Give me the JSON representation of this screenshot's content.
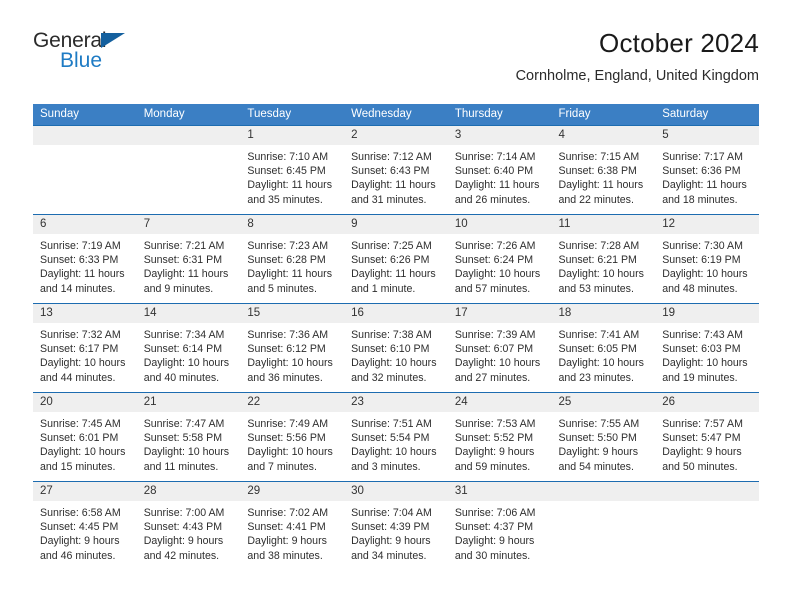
{
  "brand": {
    "name_part1": "General",
    "name_part2": "Blue",
    "triangle_color": "#14609e",
    "blue_color": "#1e7bc4"
  },
  "header": {
    "title": "October 2024",
    "subtitle": "Cornholme, England, United Kingdom"
  },
  "theme": {
    "header_row_bg": "#3b7fc4",
    "week_divider": "#1d6cb0",
    "daynum_bg": "#efefef"
  },
  "weekdays": [
    "Sunday",
    "Monday",
    "Tuesday",
    "Wednesday",
    "Thursday",
    "Friday",
    "Saturday"
  ],
  "weeks": [
    [
      {
        "day": "",
        "sunrise": "",
        "sunset": "",
        "daylight": ""
      },
      {
        "day": "",
        "sunrise": "",
        "sunset": "",
        "daylight": ""
      },
      {
        "day": "1",
        "sunrise": "Sunrise: 7:10 AM",
        "sunset": "Sunset: 6:45 PM",
        "daylight": "Daylight: 11 hours and 35 minutes."
      },
      {
        "day": "2",
        "sunrise": "Sunrise: 7:12 AM",
        "sunset": "Sunset: 6:43 PM",
        "daylight": "Daylight: 11 hours and 31 minutes."
      },
      {
        "day": "3",
        "sunrise": "Sunrise: 7:14 AM",
        "sunset": "Sunset: 6:40 PM",
        "daylight": "Daylight: 11 hours and 26 minutes."
      },
      {
        "day": "4",
        "sunrise": "Sunrise: 7:15 AM",
        "sunset": "Sunset: 6:38 PM",
        "daylight": "Daylight: 11 hours and 22 minutes."
      },
      {
        "day": "5",
        "sunrise": "Sunrise: 7:17 AM",
        "sunset": "Sunset: 6:36 PM",
        "daylight": "Daylight: 11 hours and 18 minutes."
      }
    ],
    [
      {
        "day": "6",
        "sunrise": "Sunrise: 7:19 AM",
        "sunset": "Sunset: 6:33 PM",
        "daylight": "Daylight: 11 hours and 14 minutes."
      },
      {
        "day": "7",
        "sunrise": "Sunrise: 7:21 AM",
        "sunset": "Sunset: 6:31 PM",
        "daylight": "Daylight: 11 hours and 9 minutes."
      },
      {
        "day": "8",
        "sunrise": "Sunrise: 7:23 AM",
        "sunset": "Sunset: 6:28 PM",
        "daylight": "Daylight: 11 hours and 5 minutes."
      },
      {
        "day": "9",
        "sunrise": "Sunrise: 7:25 AM",
        "sunset": "Sunset: 6:26 PM",
        "daylight": "Daylight: 11 hours and 1 minute."
      },
      {
        "day": "10",
        "sunrise": "Sunrise: 7:26 AM",
        "sunset": "Sunset: 6:24 PM",
        "daylight": "Daylight: 10 hours and 57 minutes."
      },
      {
        "day": "11",
        "sunrise": "Sunrise: 7:28 AM",
        "sunset": "Sunset: 6:21 PM",
        "daylight": "Daylight: 10 hours and 53 minutes."
      },
      {
        "day": "12",
        "sunrise": "Sunrise: 7:30 AM",
        "sunset": "Sunset: 6:19 PM",
        "daylight": "Daylight: 10 hours and 48 minutes."
      }
    ],
    [
      {
        "day": "13",
        "sunrise": "Sunrise: 7:32 AM",
        "sunset": "Sunset: 6:17 PM",
        "daylight": "Daylight: 10 hours and 44 minutes."
      },
      {
        "day": "14",
        "sunrise": "Sunrise: 7:34 AM",
        "sunset": "Sunset: 6:14 PM",
        "daylight": "Daylight: 10 hours and 40 minutes."
      },
      {
        "day": "15",
        "sunrise": "Sunrise: 7:36 AM",
        "sunset": "Sunset: 6:12 PM",
        "daylight": "Daylight: 10 hours and 36 minutes."
      },
      {
        "day": "16",
        "sunrise": "Sunrise: 7:38 AM",
        "sunset": "Sunset: 6:10 PM",
        "daylight": "Daylight: 10 hours and 32 minutes."
      },
      {
        "day": "17",
        "sunrise": "Sunrise: 7:39 AM",
        "sunset": "Sunset: 6:07 PM",
        "daylight": "Daylight: 10 hours and 27 minutes."
      },
      {
        "day": "18",
        "sunrise": "Sunrise: 7:41 AM",
        "sunset": "Sunset: 6:05 PM",
        "daylight": "Daylight: 10 hours and 23 minutes."
      },
      {
        "day": "19",
        "sunrise": "Sunrise: 7:43 AM",
        "sunset": "Sunset: 6:03 PM",
        "daylight": "Daylight: 10 hours and 19 minutes."
      }
    ],
    [
      {
        "day": "20",
        "sunrise": "Sunrise: 7:45 AM",
        "sunset": "Sunset: 6:01 PM",
        "daylight": "Daylight: 10 hours and 15 minutes."
      },
      {
        "day": "21",
        "sunrise": "Sunrise: 7:47 AM",
        "sunset": "Sunset: 5:58 PM",
        "daylight": "Daylight: 10 hours and 11 minutes."
      },
      {
        "day": "22",
        "sunrise": "Sunrise: 7:49 AM",
        "sunset": "Sunset: 5:56 PM",
        "daylight": "Daylight: 10 hours and 7 minutes."
      },
      {
        "day": "23",
        "sunrise": "Sunrise: 7:51 AM",
        "sunset": "Sunset: 5:54 PM",
        "daylight": "Daylight: 10 hours and 3 minutes."
      },
      {
        "day": "24",
        "sunrise": "Sunrise: 7:53 AM",
        "sunset": "Sunset: 5:52 PM",
        "daylight": "Daylight: 9 hours and 59 minutes."
      },
      {
        "day": "25",
        "sunrise": "Sunrise: 7:55 AM",
        "sunset": "Sunset: 5:50 PM",
        "daylight": "Daylight: 9 hours and 54 minutes."
      },
      {
        "day": "26",
        "sunrise": "Sunrise: 7:57 AM",
        "sunset": "Sunset: 5:47 PM",
        "daylight": "Daylight: 9 hours and 50 minutes."
      }
    ],
    [
      {
        "day": "27",
        "sunrise": "Sunrise: 6:58 AM",
        "sunset": "Sunset: 4:45 PM",
        "daylight": "Daylight: 9 hours and 46 minutes."
      },
      {
        "day": "28",
        "sunrise": "Sunrise: 7:00 AM",
        "sunset": "Sunset: 4:43 PM",
        "daylight": "Daylight: 9 hours and 42 minutes."
      },
      {
        "day": "29",
        "sunrise": "Sunrise: 7:02 AM",
        "sunset": "Sunset: 4:41 PM",
        "daylight": "Daylight: 9 hours and 38 minutes."
      },
      {
        "day": "30",
        "sunrise": "Sunrise: 7:04 AM",
        "sunset": "Sunset: 4:39 PM",
        "daylight": "Daylight: 9 hours and 34 minutes."
      },
      {
        "day": "31",
        "sunrise": "Sunrise: 7:06 AM",
        "sunset": "Sunset: 4:37 PM",
        "daylight": "Daylight: 9 hours and 30 minutes."
      },
      {
        "day": "",
        "sunrise": "",
        "sunset": "",
        "daylight": ""
      },
      {
        "day": "",
        "sunrise": "",
        "sunset": "",
        "daylight": ""
      }
    ]
  ]
}
